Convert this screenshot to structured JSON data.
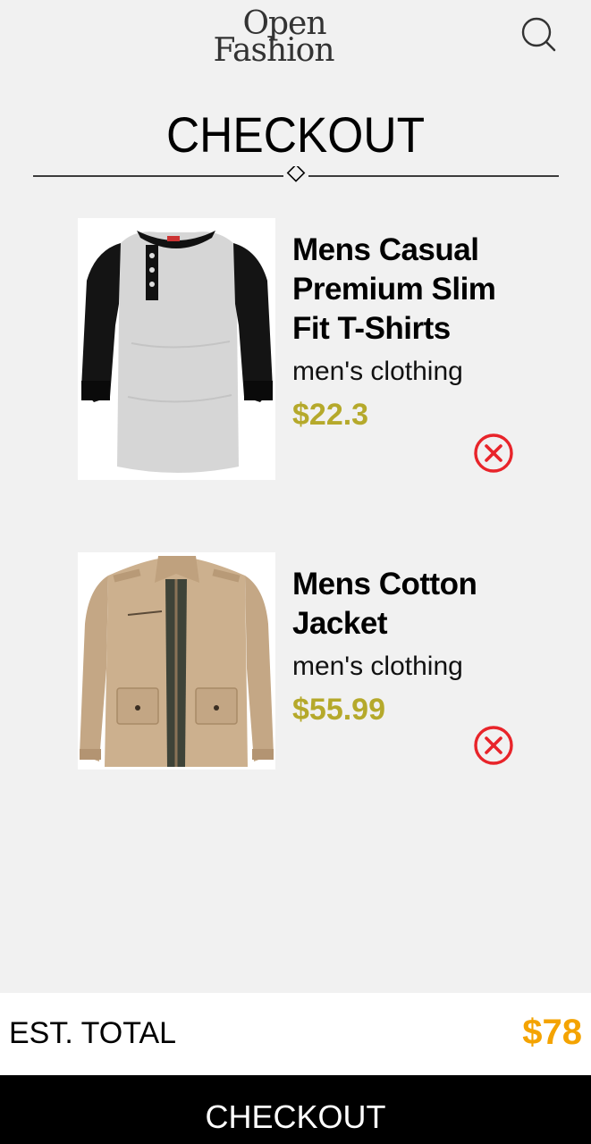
{
  "header": {
    "logo_line1": "Open",
    "logo_line2": "Fashion",
    "search_icon": "search-icon"
  },
  "page": {
    "title": "CHECKOUT"
  },
  "cart": {
    "items": [
      {
        "name": "Mens Casual Premium Slim Fit T-Shirts",
        "category": "men's clothing",
        "price": "$22.3",
        "image": "raglan-henley-tshirt-image",
        "remove_icon": "close-circle-icon"
      },
      {
        "name": "Mens Cotton Jacket",
        "category": "men's clothing",
        "price": "$55.99",
        "image": "khaki-cotton-jacket-image",
        "remove_icon": "close-circle-icon"
      }
    ]
  },
  "summary": {
    "total_label": "EST. TOTAL",
    "total_value": "$78"
  },
  "actions": {
    "checkout_label": "CHECKOUT"
  },
  "colors": {
    "price": "#b5a92b",
    "total": "#f4a300",
    "remove": "#e8242a",
    "checkout_bg": "#000000"
  }
}
